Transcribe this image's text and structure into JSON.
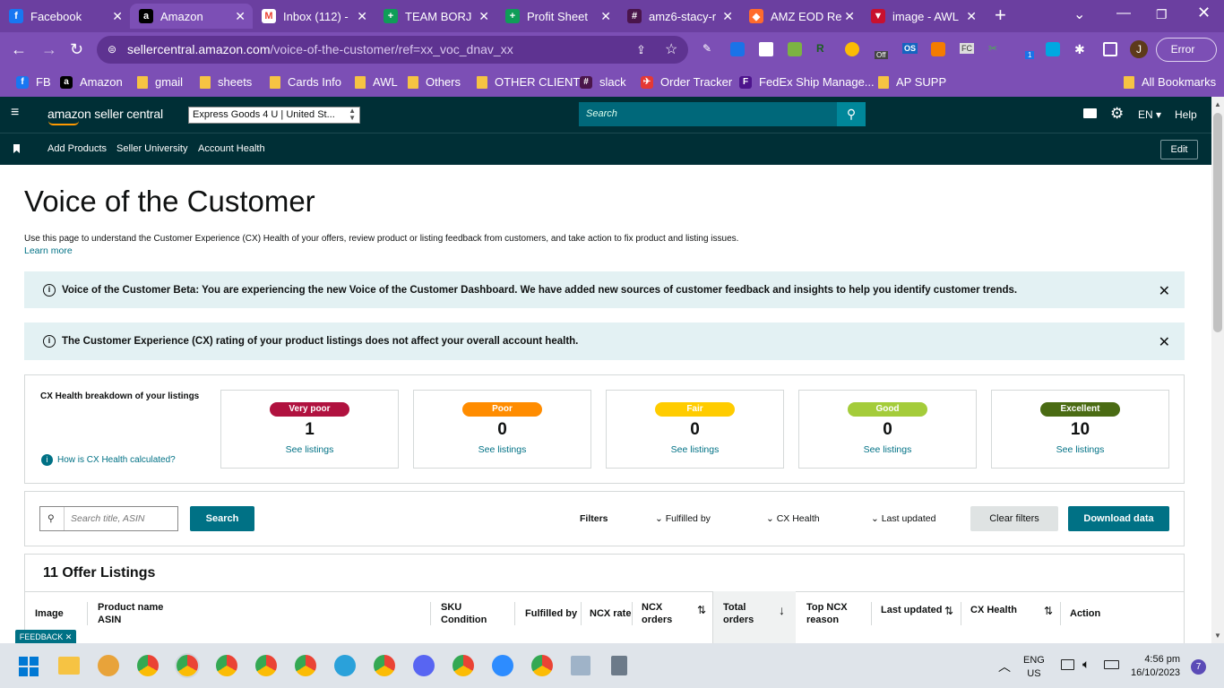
{
  "browser": {
    "tabs": [
      {
        "title": "Facebook",
        "favicon": "facebook-icon",
        "color": "#1877f2",
        "glyph": "f"
      },
      {
        "title": "Amazon",
        "favicon": "amazon-icon",
        "color": "#000000",
        "glyph": "a"
      },
      {
        "title": "Inbox (112) -",
        "favicon": "gmail-icon",
        "color": "#ffffff",
        "glyph": "M"
      },
      {
        "title": "TEAM BORJ",
        "favicon": "sheets-icon",
        "color": "#0f9d58",
        "glyph": "+"
      },
      {
        "title": "Profit Sheet",
        "favicon": "sheets-icon",
        "color": "#0f9d58",
        "glyph": "+"
      },
      {
        "title": "amz6-stacy-r",
        "favicon": "slack-icon",
        "color": "#4a154b",
        "glyph": "#"
      },
      {
        "title": "AMZ EOD Re",
        "favicon": "clickup-icon",
        "color": "#ff6b2c",
        "glyph": "◆"
      },
      {
        "title": "image - AWL",
        "favicon": "awl-icon",
        "color": "#c8102e",
        "glyph": "▼"
      }
    ],
    "new_tab": "+",
    "url_host": "sellercentral.amazon.com",
    "url_path": "/voice-of-the-customer/ref=xx_voc_dnav_xx",
    "profile_initial": "J",
    "error_label": "Error",
    "extension_badge": "1",
    "extension_off": "Off",
    "extension_os": "OS",
    "extension_fc": "FC",
    "bookmarks": [
      {
        "label": "FB",
        "kind": "facebook-icon"
      },
      {
        "label": "Amazon",
        "kind": "amazon-icon"
      },
      {
        "label": "gmail",
        "kind": "folder-icon"
      },
      {
        "label": "sheets",
        "kind": "folder-icon"
      },
      {
        "label": "Cards Info",
        "kind": "folder-icon"
      },
      {
        "label": "AWL",
        "kind": "folder-icon"
      },
      {
        "label": "Others",
        "kind": "folder-icon"
      },
      {
        "label": "OTHER CLIENT",
        "kind": "folder-icon"
      },
      {
        "label": "slack",
        "kind": "slack-icon"
      },
      {
        "label": "Order Tracker",
        "kind": "tracker-icon"
      },
      {
        "label": "FedEx Ship Manage...",
        "kind": "fedex-icon"
      },
      {
        "label": "AP SUPP",
        "kind": "folder-icon"
      }
    ],
    "all_bookmarks": "All Bookmarks"
  },
  "header": {
    "logo": "amazon seller central",
    "store_select": "Express Goods 4 U | United St...",
    "search_placeholder": "Search",
    "language": "EN",
    "help": "Help",
    "nav": [
      "Add Products",
      "Seller University",
      "Account Health"
    ],
    "edit": "Edit"
  },
  "page": {
    "title": "Voice of the Customer",
    "description": "Use this page to understand the Customer Experience (CX) Health of your offers, review product or listing feedback from customers, and take action to fix product and listing issues.",
    "learn_more": "Learn more",
    "banners": [
      "Voice of the Customer Beta: You are experiencing the new Voice of the Customer Dashboard. We have added new sources of customer feedback and insights to help you identify customer trends.",
      "The Customer Experience (CX) rating of your product listings does not affect your overall account health."
    ],
    "breakdown_title": "CX Health breakdown of your listings",
    "how_calculated": "How is CX Health calculated?",
    "health_cards": [
      {
        "label": "Very poor",
        "count": "1",
        "link": "See listings",
        "bg": "#b0123f",
        "fg": "#ffffff"
      },
      {
        "label": "Poor",
        "count": "0",
        "link": "See listings",
        "bg": "#ff8c00",
        "fg": "#ffffff"
      },
      {
        "label": "Fair",
        "count": "0",
        "link": "See listings",
        "bg": "#ffcc00",
        "fg": "#ffffff"
      },
      {
        "label": "Good",
        "count": "0",
        "link": "See listings",
        "bg": "#a4cc3a",
        "fg": "#ffffff"
      },
      {
        "label": "Excellent",
        "count": "10",
        "link": "See listings",
        "bg": "#4a6b13",
        "fg": "#ffffff"
      }
    ],
    "search_placeholder": "Search title, ASIN",
    "search_button": "Search",
    "filters_label": "Filters",
    "filters": [
      "Fulfilled by",
      "CX Health",
      "Last updated"
    ],
    "clear_filters": "Clear filters",
    "download": "Download data",
    "listings_title": "11 Offer Listings",
    "columns": {
      "image": "Image",
      "product": "Product name",
      "asin": "ASIN",
      "sku": "SKU",
      "condition": "Condition",
      "fulfilled": "Fulfilled by",
      "ncx_rate": "NCX rate",
      "ncx_orders_1": "NCX",
      "ncx_orders_2": "orders",
      "total_1": "Total",
      "total_2": "orders",
      "top_1": "Top NCX",
      "top_2": "reason",
      "last_updated": "Last updated",
      "cx_health": "CX Health",
      "action": "Action"
    },
    "feedback": "FEEDBACK"
  },
  "taskbar": {
    "lang_1": "ENG",
    "lang_2": "US",
    "time": "4:56 pm",
    "date": "16/10/2023",
    "notifications": "7"
  }
}
